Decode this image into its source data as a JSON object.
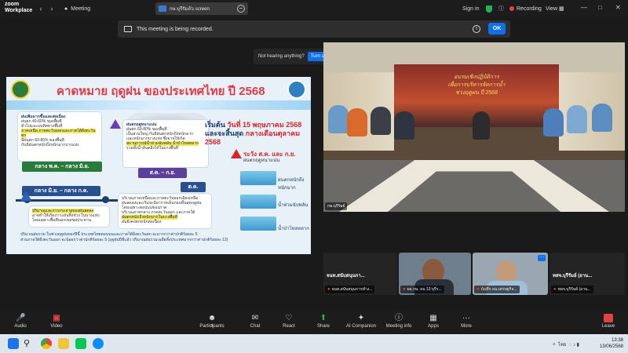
{
  "app": {
    "brand_line1": "zoom",
    "brand_line2": "Workplace"
  },
  "topbar": {
    "meeting_label": "Meeting",
    "share_title": "กษ.บุรีรัมย์'s screen",
    "signin": "Sign in",
    "recording": "Recording",
    "view": "View"
  },
  "recording_banner": {
    "text": "This meeting is being recorded.",
    "ok_label": "OK"
  },
  "audio_prompt": {
    "text": "Not hearing anything?",
    "button_label": "Turn up volume"
  },
  "slide": {
    "title": "คาดหมาย ฤดูฝน ของประเทศไทย ปี 2568",
    "card1": {
      "head": "ฝนเพิ่มมากขึ้นและต่อเนื่อง",
      "l1": "ฝนตก 40-60% ของพื้นที่",
      "l2": "ทั่วไปและบนทิศทางพื้นที่",
      "l3": "ภาคเหนือ ภาคตะวันออกและภาคใต้ฝั่งตะวันตก",
      "l4": "มีฝนตก 60-80% ของพื้นที่",
      "l5": "กับมีฝนตกหนักถึงหนักมากบางแห่ง"
    },
    "card2": {
      "head": "ฝนตกฤดูหนาแน่น",
      "l1": "ฝนตก 60-80% ของพื้นที่",
      "l2": "เป็นส่วนใหญ่ กับมีฝนตกหนักถึงหนักมาก",
      "l3": "และหนักมากบางแห่ง ซึ่งอาจให้เกิด",
      "l4": "สถานการณ์น้ำท่วมฉับพลัน น้ำป่าไหลหลาก",
      "l5": "รวมทั้งน้ำล้นตลิ่งได้ในบางพื้นที่"
    },
    "card3": {
      "l1": "ปริมาณและการกระจายของฝนลดลง",
      "l2": "อาจทำให้เกิดภาวะฝนทิ้งช่วง ในบางแห่ง",
      "l3": "โดยเฉพาะพื้นที่นอกเขตชลประทาน"
    },
    "card4": {
      "l1": "บริเวณภาคเหนือและภาคตะวันออกเฉียงเหนือ",
      "l2": "ฝนลดลงและเริ่มจะมีอากาศเย็นก่อนสิ้นสุดฤดูฝน",
      "l3": "โดยเฉพาะตอนบนของภาค",
      "l4": "บริเวณภาคกลาง ภาคตะวันออก และภาคใต้",
      "l5": "ฝนตกหนักถึงหนักมากในบางพื้นที่",
      "l6": "ฝนยังคงตกหนักต่อเนื่อง"
    },
    "tag_green": "กลาง พ.ค. – กลาง มิ.ย.",
    "tag_purple": "ส.ค. – ก.ย.",
    "tag_blue1": "กลาง มิ.ย. – กลาง ก.ค.",
    "tag_blue2": "ต.ค.",
    "start_l1": "เริ่มต้น",
    "start_date": "วันที่ 15 พฤษภาคม 2568",
    "start_l2": "และจะสิ้นสุด",
    "start_end": "กลางเดือนตุลาคม 2568",
    "warn_title": "ระวัง ส.ค. และ ก.ย.",
    "warn_sub": "ฝนตกฤดูหนาแน่น",
    "rain1": "ฝนตกหนักถึงหนักมาก",
    "rain2": "น้ำท่วมฉับพลัน",
    "rain3": "น้ำป่าไหลหลาก",
    "note1": "ปริมาณฝนรวม ในช่วงฤดูฝนของปีนี้ ประเทศไทยตอนบนและภาคใต้ฝั่งตะวันตก จะมากกว่าค่าปกติร้อยละ 5",
    "note2": "ส่วนภาคใต้ฝั่งตะวันออก จะน้อยกว่าค่าปกติร้อยละ 5 (ฤดูฝนปีที่แล้ว ปริมาณฝนรวมเฉลี่ยทั้งประเทศมากกว่าค่าปกติร้อยละ 12)"
  },
  "main_video": {
    "caption": "กษ.บุรีรัมย์",
    "banner_l1": "อบรมเชิงปฏิบัติการ",
    "banner_l2": "เพื่อการบริหารจัดการน้ำ",
    "banner_l3": "ช่วงฤดูฝน ปี 2568"
  },
  "tiles": [
    {
      "name": "จนท.สนับสนุนกา...",
      "caption": "จนท.สนับสนุนการทำง..."
    },
    {
      "name": "",
      "caption": "ผอ.กษ. ลน 13 บุรีร..."
    },
    {
      "name": "",
      "caption": "บันทึก ลน.เศรษฐกิจ..."
    },
    {
      "name": "ทสจ.บุรีรัมย์ (อาน...",
      "caption": "ทสจ.บุรีรัมย์ (อาน..."
    }
  ],
  "toolbar": {
    "audio": "Audio",
    "video": "Video",
    "participants": "Participants",
    "participants_count": "5",
    "chat": "Chat",
    "react": "React",
    "share": "Share",
    "ai_companion": "AI Companion",
    "meeting_info": "Meeting info",
    "apps": "Apps",
    "more": "More",
    "leave": "Leave"
  },
  "taskbar": {
    "lang": "ไทย",
    "time": "13:38",
    "date": "13/06/2568"
  },
  "colors": {
    "accent": "#0e71eb",
    "recording": "#e0443d",
    "slide_title": "#e03a47"
  }
}
